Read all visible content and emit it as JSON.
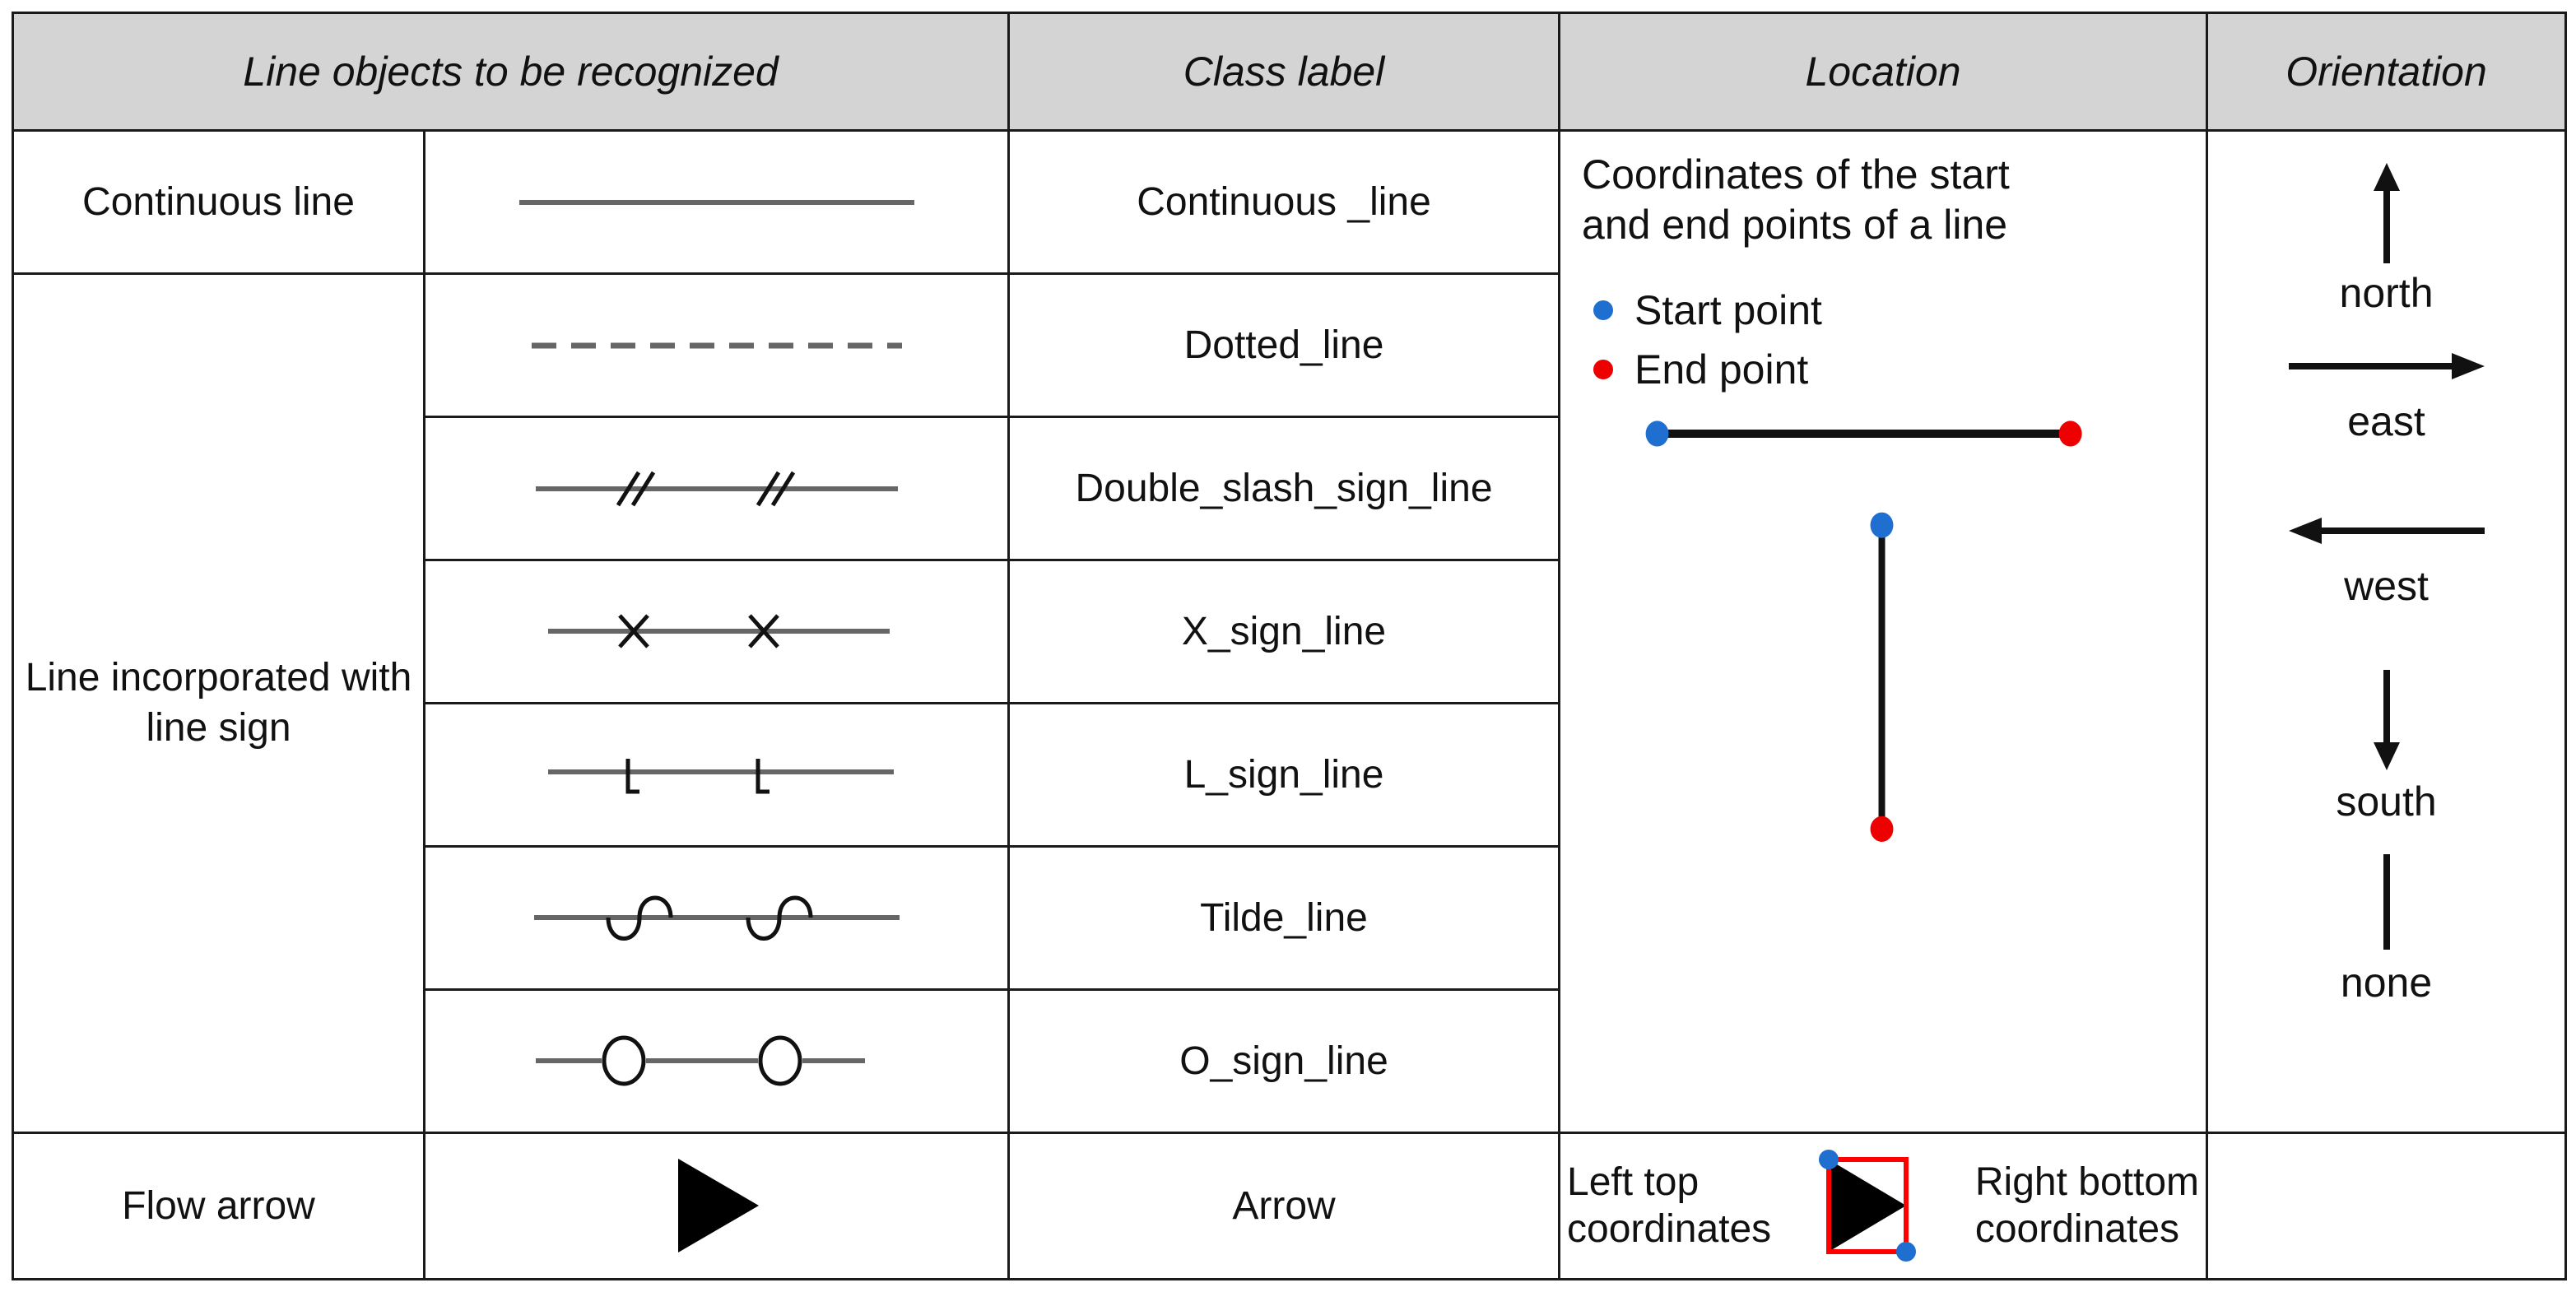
{
  "table": {
    "headers": [
      {
        "id": "line-objects",
        "label": "Line objects to be recognized"
      },
      {
        "id": "class-label",
        "label": "Class label"
      },
      {
        "id": "location",
        "label": "Location"
      },
      {
        "id": "orientation",
        "label": "Orientation"
      }
    ],
    "group_labels": {
      "continuous": "Continuous line",
      "line_sign": "Line\nincorporated\nwith line sign",
      "flow_arrow": "Flow arrow"
    },
    "rows": [
      {
        "glyph": "solid-line",
        "class_label": "Continuous _line"
      },
      {
        "glyph": "dashed-line",
        "class_label": "Dotted_line"
      },
      {
        "glyph": "double-slash-line",
        "class_label": "Double_slash_sign_line"
      },
      {
        "glyph": "x-sign-line",
        "class_label": "X_sign_line"
      },
      {
        "glyph": "l-sign-line",
        "class_label": "L_sign_line"
      },
      {
        "glyph": "tilde-line",
        "class_label": "Tilde_line"
      },
      {
        "glyph": "o-sign-line",
        "class_label": "O_sign_line"
      },
      {
        "glyph": "filled-triangle-arrow",
        "class_label": "Arrow"
      }
    ]
  },
  "location": {
    "description": "Coordinates of the start\nand end points of a line",
    "legend": [
      {
        "label": "Start point",
        "color": "#1f6fd0",
        "icon": "blue-dot-icon"
      },
      {
        "label": "End point",
        "color": "#ee0000",
        "icon": "red-dot-icon"
      }
    ],
    "figures": {
      "horizontal_line": {
        "start": "blue",
        "end": "red"
      },
      "vertical_line": {
        "start": "blue",
        "end": "red"
      }
    },
    "bbox_row": {
      "left_text": "Left top\ncoordinates",
      "right_text": "Right bottom\ncoordinates",
      "box_color": "#ff0000",
      "handle_color": "#1f6fd0"
    }
  },
  "orientation": {
    "items": [
      {
        "icon": "arrow-up-icon",
        "label": "north"
      },
      {
        "icon": "arrow-right-icon",
        "label": "east"
      },
      {
        "icon": "arrow-left-icon",
        "label": "west"
      },
      {
        "icon": "arrow-down-icon",
        "label": "south"
      },
      {
        "icon": "plain-line-icon",
        "label": "none"
      }
    ]
  },
  "colors": {
    "header_bg": "#d4d4d4",
    "border": "#1a1a1a",
    "glyph_gray": "#666666",
    "ink": "#111111",
    "blue": "#1f6fd0",
    "red": "#ee0000",
    "bbox_red": "#ff0000"
  }
}
